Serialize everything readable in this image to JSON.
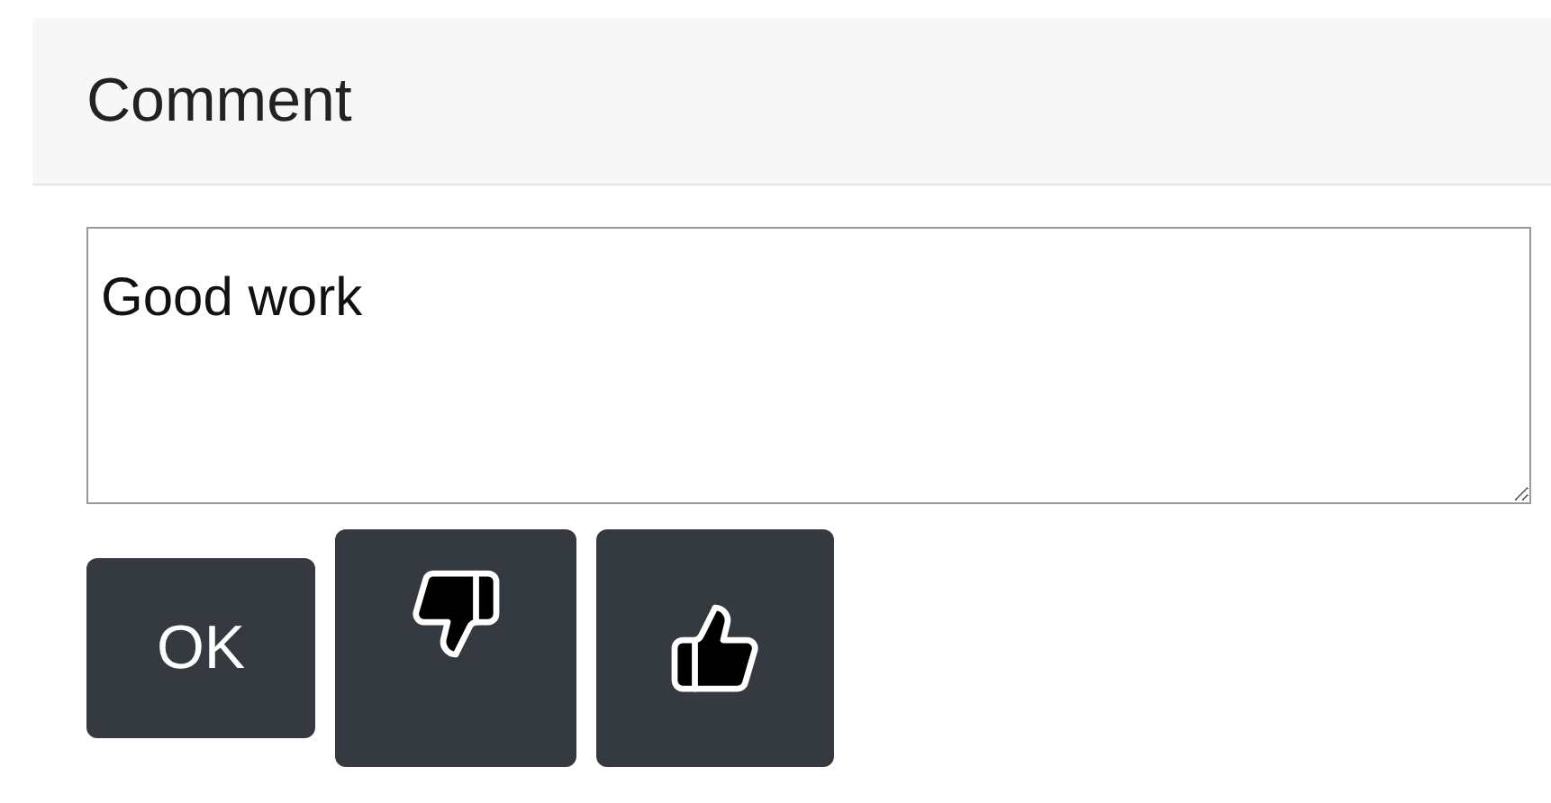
{
  "panel": {
    "title": "Comment"
  },
  "comment_field": {
    "value": "Good work"
  },
  "buttons": [
    {
      "kind": "text",
      "label": "OK"
    },
    {
      "kind": "thumbs-down"
    },
    {
      "kind": "thumbs-up"
    }
  ]
}
